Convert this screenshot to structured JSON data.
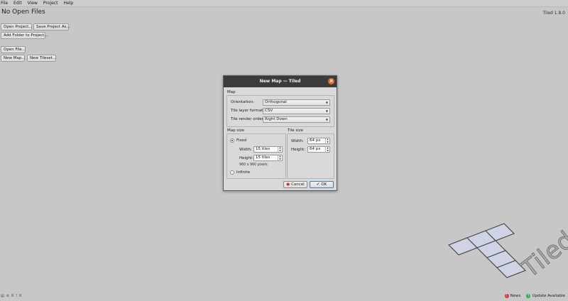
{
  "menu": [
    "File",
    "Edit",
    "View",
    "Project",
    "Help"
  ],
  "main": {
    "heading": "No Open Files",
    "version": "Tiled 1.8.0",
    "buttons": {
      "open_project": "Open Project...",
      "save_project_as": "Save Project As...",
      "add_folder": "Add Folder to Project...",
      "open_file": "Open File...",
      "new_map": "New Map...",
      "new_tileset": "New Tileset..."
    }
  },
  "dialog": {
    "title": "New Map — Tiled",
    "map_group": "Map",
    "orientation_label": "Orientation:",
    "orientation_value": "Orthogonal",
    "layer_format_label": "Tile layer format:",
    "layer_format_value": "CSV",
    "render_order_label": "Tile render order:",
    "render_order_value": "Right Down",
    "map_size_group": "Map size",
    "fixed_label": "Fixed",
    "width_label": "Width:",
    "width_value": "15 tiles",
    "height_label": "Height:",
    "height_value": "15 tiles",
    "pixel_size": "960 x 960 pixels",
    "infinite_label": "Infinite",
    "tile_size_group": "Tile size",
    "tile_width_label": "Width:",
    "tile_width_value": "64 px",
    "tile_height_label": "Height:",
    "tile_height_value": "64 px",
    "cancel_label": "Cancel",
    "ok_label": "OK"
  },
  "logo_text": "Tiled",
  "status": {
    "errors": "0",
    "warnings": "0",
    "news": "News",
    "update": "Update Available"
  },
  "colors": {
    "background": "#c7c7c7",
    "dialog_titlebar": "#3b3b3b",
    "close_button": "#e66b2b",
    "news_dot": "#d83a3a",
    "update_dot": "#3aaa4a"
  }
}
